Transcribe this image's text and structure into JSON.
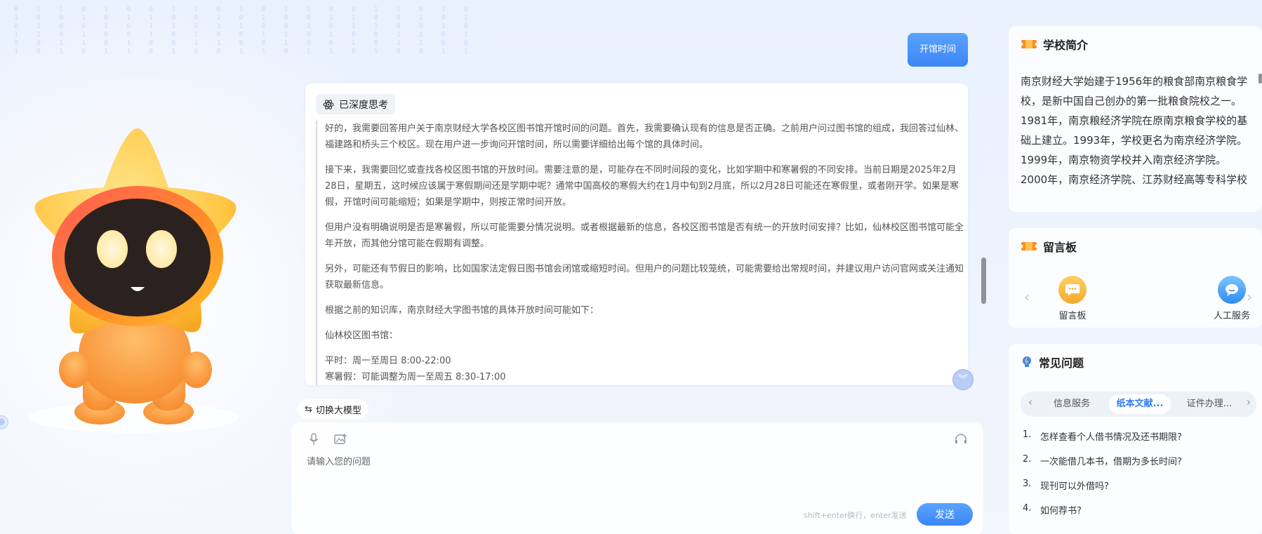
{
  "chat": {
    "user_message": "开馆时间",
    "think_label": "已深度思考",
    "think_paragraphs": [
      "好的，我需要回答用户关于南京财经大学各校区图书馆开馆时间的问题。首先，我需要确认现有的信息是否正确。之前用户问过图书馆的组成，我回答过仙林、福建路和桥头三个校区。现在用户进一步询问开馆时间，所以需要详细给出每个馆的具体时间。",
      "接下来，我需要回忆或查找各校区图书馆的开放时间。需要注意的是，可能存在不同时间段的变化，比如学期中和寒暑假的不同安排。当前日期是2025年2月28日，星期五，这时候应该属于寒假期间还是学期中呢？通常中国高校的寒假大约在1月中旬到2月底，所以2月28日可能还在寒假里，或者刚开学。如果是寒假，开馆时间可能缩短；如果是学期中，则按正常时间开放。",
      "但用户没有明确说明是否是寒暑假，所以可能需要分情况说明。或者根据最新的信息，各校区图书馆是否有统一的开放时间安排？比如，仙林校区图书馆可能全年开放，而其他分馆可能在假期有调整。",
      "另外，可能还有节假日的影响，比如国家法定假日图书馆会闭馆或缩短时间。但用户的问题比较笼统，可能需要给出常规时间，并建议用户访问官网或关注通知获取最新信息。",
      "根据之前的知识库，南京财经大学图书馆的具体开放时间可能如下：",
      "仙林校区图书馆："
    ],
    "think_lines": [
      "平时：周一至周日 8:00-22:00",
      "寒暑假：可能调整为周一至周五 8:30-17:00"
    ],
    "switch_model_label": "切换大模型",
    "input_placeholder": "请输入您的问题",
    "input_hint": "shift+enter换行，enter发送",
    "send_label": "发送"
  },
  "panels": {
    "intro": {
      "title": "学校简介",
      "text": "南京财经大学始建于1956年的粮食部南京粮食学校，是新中国自己创办的第一批粮食院校之一。1981年，南京粮经济学院在原南京粮食学校的基础上建立。1993年，学校更名为南京经济学院。1999年，南京物资学校并入南京经济学院。2000年，南京经济学院、江苏财经高等专科学校"
    },
    "board": {
      "title": "留言板",
      "items": [
        {
          "label": "留言板"
        },
        {
          "label": "人工服务"
        }
      ]
    },
    "faq": {
      "title": "常见问题",
      "tabs": [
        "信息服务",
        "纸本文献...",
        "证件办理..."
      ],
      "active_tab": 1,
      "questions": [
        {
          "num": "1.",
          "text": "怎样查看个人借书情况及还书期限?"
        },
        {
          "num": "2.",
          "text": "一次能借几本书，借期为多长时间?"
        },
        {
          "num": "3.",
          "text": "现刊可以外借吗?"
        },
        {
          "num": "4.",
          "text": "如何荐书?"
        }
      ]
    }
  },
  "colors": {
    "accent": "#3b86f6",
    "ticket_orange": "#ff8a1e"
  }
}
